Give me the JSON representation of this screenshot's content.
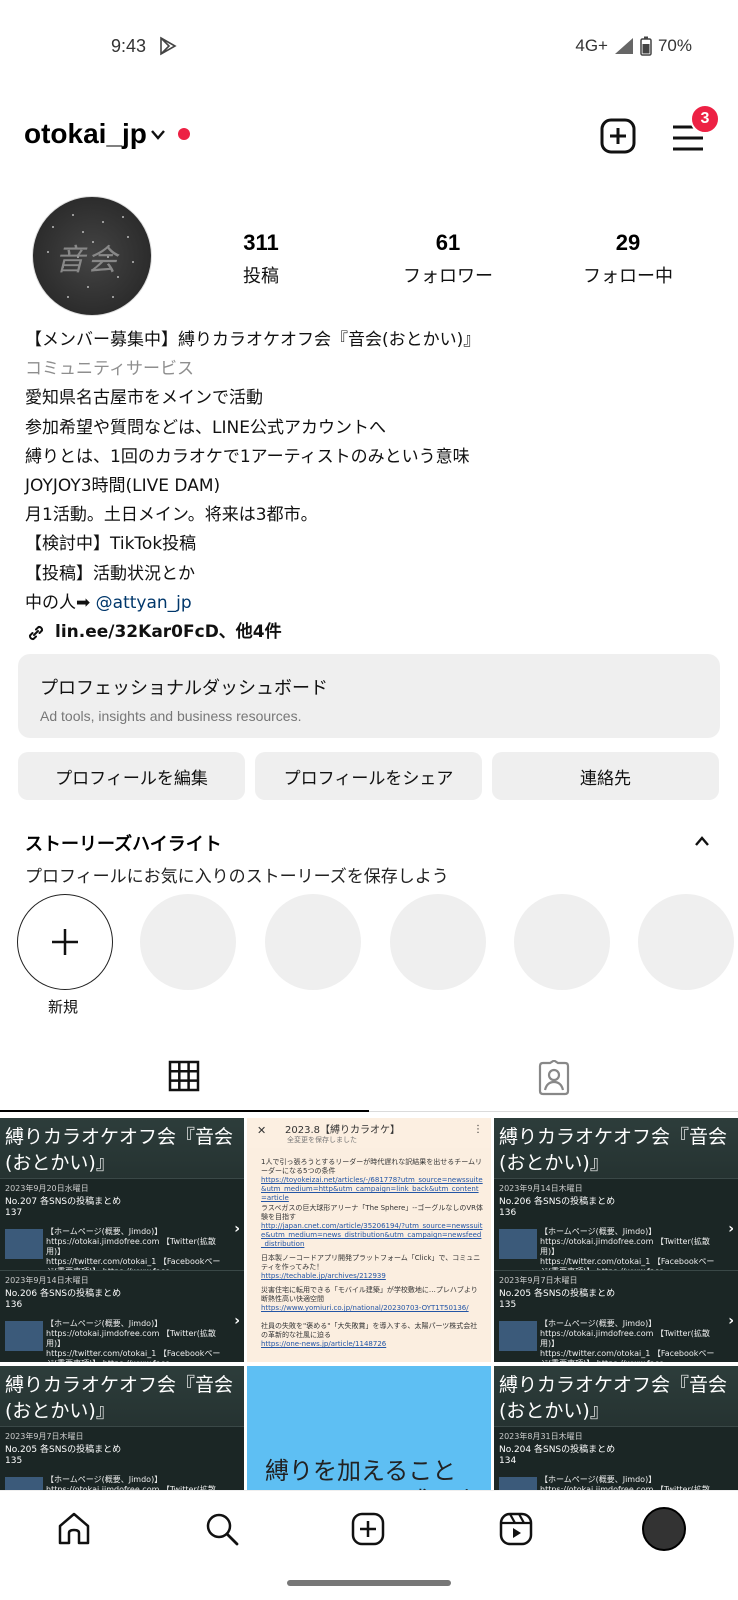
{
  "status": {
    "time": "9:43",
    "network": "4G+",
    "battery": "70%"
  },
  "header": {
    "username": "otokai_jp",
    "notification_count": "3"
  },
  "avatar": {
    "text": "音会"
  },
  "stats": [
    {
      "value": "311",
      "label": "投稿"
    },
    {
      "value": "61",
      "label": "フォロワー"
    },
    {
      "value": "29",
      "label": "フォロー中"
    }
  ],
  "bio": {
    "name": "【メンバー募集中】縛りカラオケオフ会『音会(おとかい)』",
    "category": "コミュニティサービス",
    "lines": [
      "愛知県名古屋市をメインで活動",
      "参加希望や質問などは、LINE公式アカウントへ",
      "縛りとは、1回のカラオケで1アーティストのみという意味",
      "JOYJOY3時間(LIVE DAM)",
      "月1活動。土日メイン。将来は3都市。",
      "【検討中】TikTok投稿",
      "【投稿】活動状況とか"
    ],
    "person_prefix": "中の人➡",
    "mention": "@attyan_jp",
    "link": "lin.ee/32Kar0FcD、他4件"
  },
  "dashboard": {
    "title": "プロフェッショナルダッシュボード",
    "subtitle": "Ad tools, insights and business resources."
  },
  "buttons": {
    "edit": "プロフィールを編集",
    "share": "プロフィールをシェア",
    "contact": "連絡先"
  },
  "highlights": {
    "title": "ストーリーズハイライト",
    "subtitle": "プロフィールにお気に入りのストーリーズを保存しよう",
    "new_label": "新規"
  },
  "posts": {
    "title": "縛りカラオケオフ会『音会(おとかい)』",
    "p1": [
      {
        "date": "2023年9月20日水曜日",
        "head": "No.207 各SNSの投稿まとめ\n137"
      },
      {
        "date": "2023年9月14日木曜日",
        "head": "No.206 各SNSの投稿まとめ\n136"
      }
    ],
    "p3": [
      {
        "date": "2023年9月14日木曜日",
        "head": "No.206 各SNSの投稿まとめ\n136"
      },
      {
        "date": "2023年9月7日木曜日",
        "head": "No.205 各SNSの投稿まとめ\n135"
      }
    ],
    "p4": [
      {
        "date": "2023年9月7日木曜日",
        "head": "No.205 各SNSの投稿まとめ\n135"
      }
    ],
    "p6": [
      {
        "date": "2023年8月31日木曜日",
        "head": "No.204 各SNSの投稿まとめ\n134"
      }
    ],
    "body": "【ホームページ(概要、Jimdo)】\nhttps://otokai.jimdofree.com 【Twitter(拡散用)】\nhttps://twitter.com/otokai_1 【Facebookページ(重要事項)】 https://www.face...",
    "news_title": "2023.8【縛りカラオケ】",
    "news_sub": "全変更を保存しました",
    "news_items": [
      {
        "t": "1人で引っ張ろうとするリーダーが時代遅れな訳結果を出せるチームリーダーになる5つの条件",
        "l": "https://toyokeizai.net/articles/-/681778?utm_source=newssuite&utm_medium=http&utm_campaign=link_back&utm_content=article"
      },
      {
        "t": "ラスベガスの巨大球形アリーナ「The Sphere」--ゴーグルなしのVR体験を目指す",
        "l": "http://japan.cnet.com/article/35206194/?utm_source=newssuite&utm_medium=news_distribution&utm_campaign=newsfeed_distribution"
      },
      {
        "t": "日本製ノーコードアプリ開発プラットフォーム「Click」で、コミュニティを作ってみた！",
        "l": "https://techable.jp/archives/212939"
      },
      {
        "t": "災害住宅に転用できる「モバイル建築」が学校敷地に…プレハブより断熱性高い快適空間",
        "l": "https://www.yomiuri.co.jp/national/20230703-OYT1T50136/"
      },
      {
        "t": "社員の失敗を\"褒める\"「大失敗賞」を導入する、太陽パーツ株式会社の革新的な社風に迫る",
        "l": "https://one-news.jp/article/1148726"
      }
    ],
    "blue_text": "縛りを加えることで、より一層盛り上がれる"
  },
  "colors": {
    "accent_red": "#ed2144",
    "mention_blue": "#00376b",
    "chip_gray": "#efefef"
  }
}
